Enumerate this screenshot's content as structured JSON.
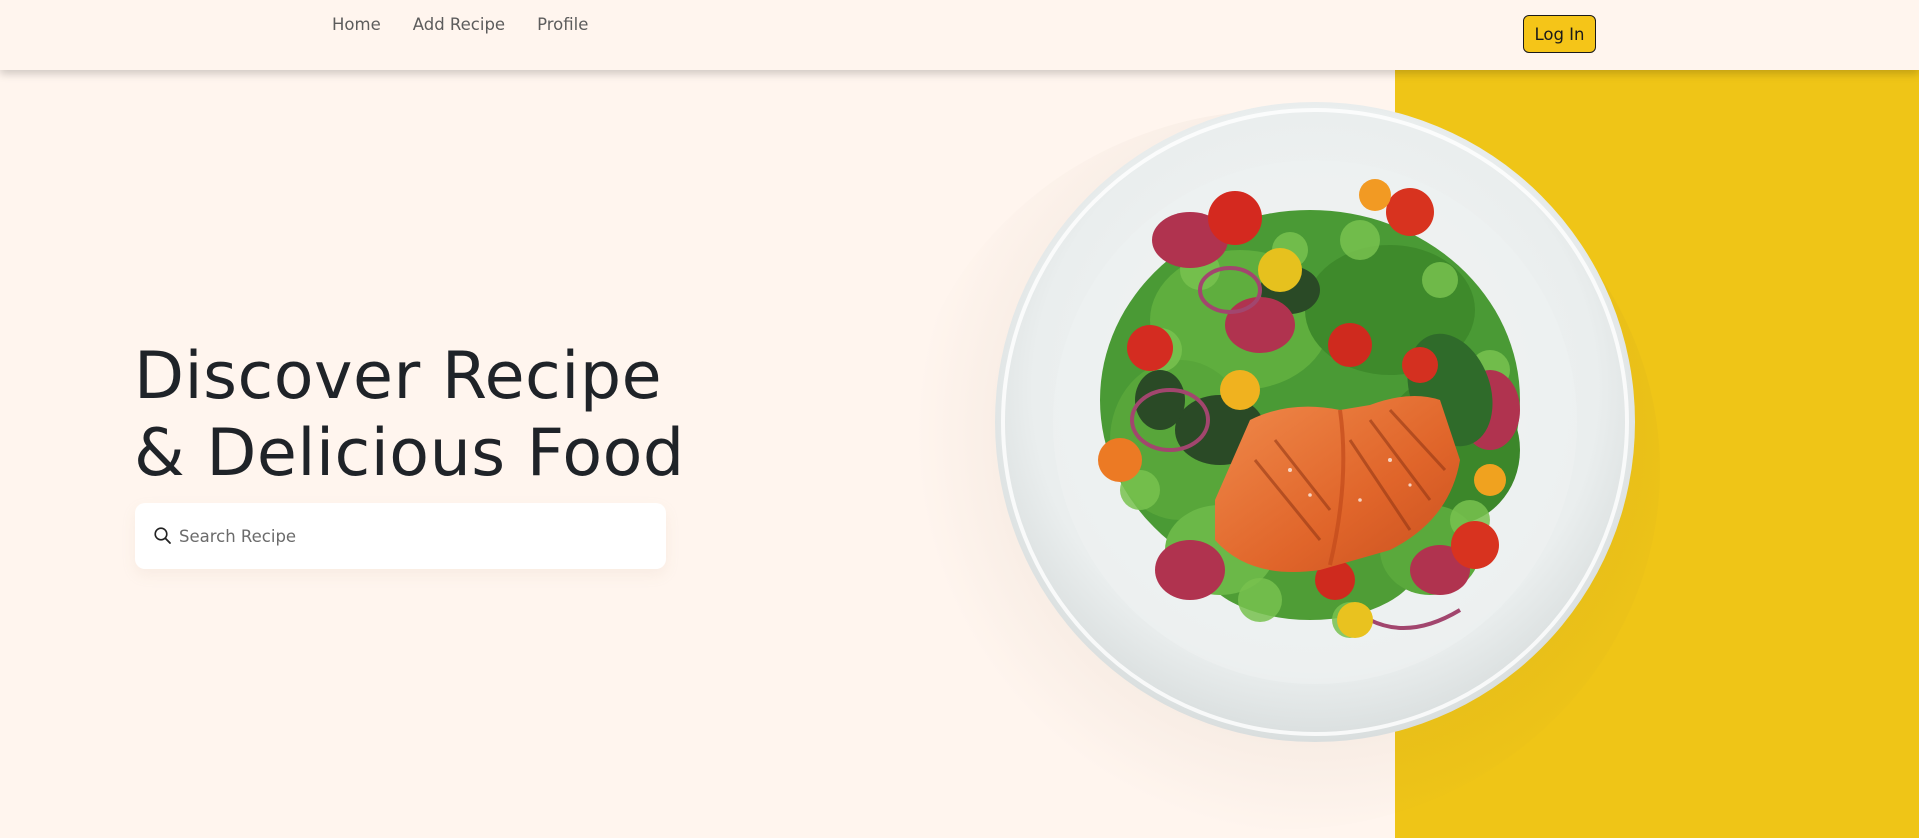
{
  "nav": {
    "links": [
      "Home",
      "Add Recipe",
      "Profile"
    ],
    "login_label": "Log In"
  },
  "hero": {
    "title_line1": "Discover Recipe",
    "title_line2": "& Delicious Food"
  },
  "search": {
    "placeholder": "Search Recipe",
    "value": "",
    "icon": "search-icon"
  },
  "colors": {
    "background": "#fff5ee",
    "accent_yellow": "#efc517",
    "button_yellow": "#f5c518",
    "text_dark": "#1f2328"
  },
  "image": {
    "subject": "salmon-salad-plate"
  }
}
